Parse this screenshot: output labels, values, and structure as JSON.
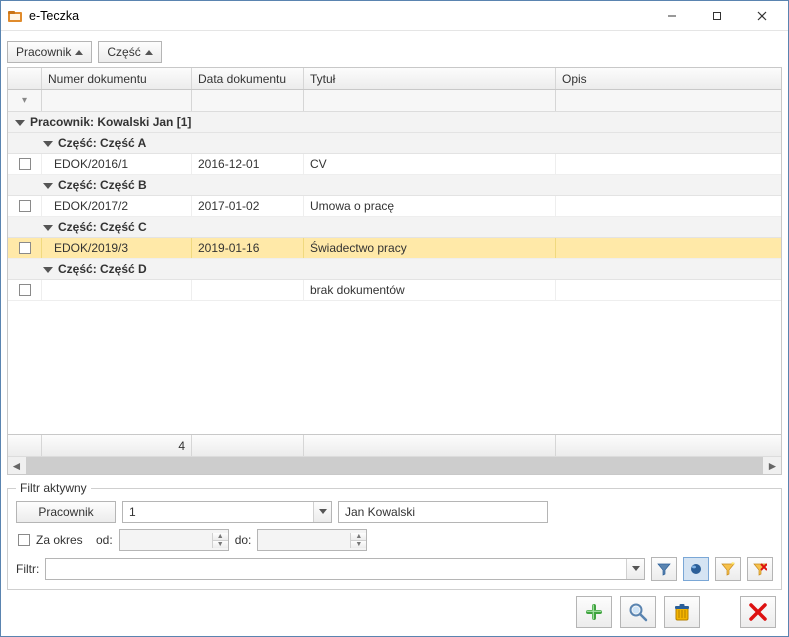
{
  "window": {
    "title": "e-Teczka"
  },
  "group_by": {
    "btn1": "Pracownik",
    "btn2": "Część"
  },
  "columns": {
    "c1": "Numer dokumentu",
    "c2": "Data dokumentu",
    "c3": "Tytuł",
    "c4": "Opis"
  },
  "groups": {
    "employee": "Pracownik: Kowalski Jan [1]",
    "part_a": "Część: Część A",
    "part_b": "Część: Część B",
    "part_c": "Część: Część C",
    "part_d": "Część: Część D"
  },
  "rows": [
    {
      "num": "EDOK/2016/1",
      "date": "2016-12-01",
      "title": "CV",
      "desc": ""
    },
    {
      "num": "EDOK/2017/2",
      "date": "2017-01-02",
      "title": "Umowa o pracę",
      "desc": ""
    },
    {
      "num": "EDOK/2019/3",
      "date": "2019-01-16",
      "title": "Świadectwo pracy",
      "desc": ""
    },
    {
      "num": "",
      "date": "",
      "title": "brak dokumentów",
      "desc": ""
    }
  ],
  "footer": {
    "count": "4"
  },
  "filter": {
    "legend": "Filtr aktywny",
    "employee_btn": "Pracownik",
    "employee_id": "1",
    "employee_name": "Jan Kowalski",
    "period_chk": "Za okres",
    "from_lbl": "od:",
    "to_lbl": "do:",
    "filter_lbl": "Filtr:",
    "filter_value": ""
  }
}
